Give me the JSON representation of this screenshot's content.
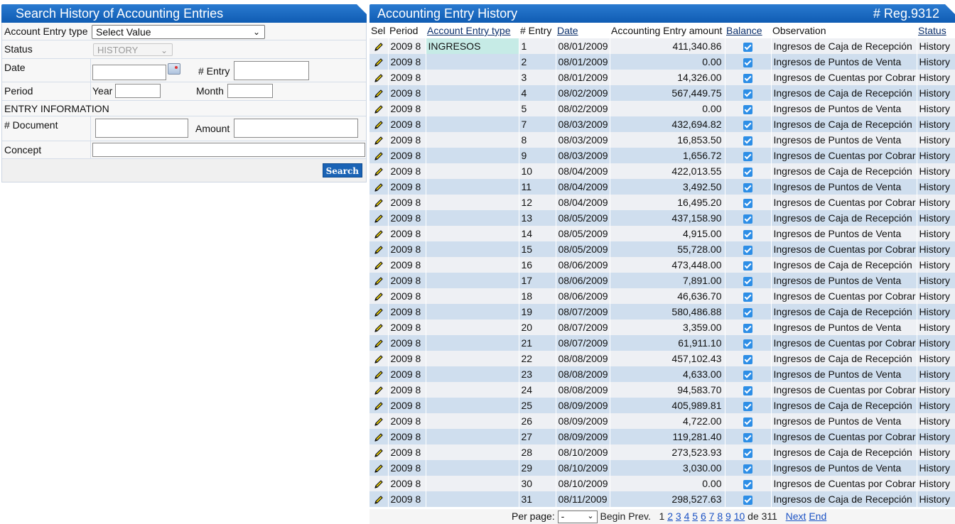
{
  "search_panel": {
    "title": "Search History of Accounting Entries",
    "fields": {
      "account_entry_type_label": "Account Entry type",
      "account_entry_type_value": "Select Value",
      "status_label": "Status",
      "status_value": "HISTORY",
      "date_label": "Date",
      "entry_label": "# Entry",
      "period_label": "Period",
      "year_label": "Year",
      "month_label": "Month",
      "entry_info_label": "ENTRY INFORMATION",
      "document_label": "# Document",
      "amount_label": "Amount",
      "concept_label": "Concept"
    },
    "search_button": "Search"
  },
  "history_panel": {
    "title": "Accounting Entry History",
    "reg_count": "# Reg.9312",
    "columns": [
      "Sel",
      "Period",
      "Account Entry type",
      "# Entry",
      "Date",
      "Accounting Entry amount",
      "Balance",
      "Observation",
      "Status"
    ],
    "rows": [
      {
        "period": "2009 8",
        "type": "INGRESOS",
        "entry": "1",
        "date": "08/01/2009",
        "amount": "411,340.86",
        "observation": "Ingresos de Caja de Recepción",
        "status": "History"
      },
      {
        "period": "2009 8",
        "type": "",
        "entry": "2",
        "date": "08/01/2009",
        "amount": "0.00",
        "observation": "Ingresos de Puntos de Venta",
        "status": "History"
      },
      {
        "period": "2009 8",
        "type": "",
        "entry": "3",
        "date": "08/01/2009",
        "amount": "14,326.00",
        "observation": "Ingresos de Cuentas por Cobrar",
        "status": "History"
      },
      {
        "period": "2009 8",
        "type": "",
        "entry": "4",
        "date": "08/02/2009",
        "amount": "567,449.75",
        "observation": "Ingresos de Caja de Recepción",
        "status": "History"
      },
      {
        "period": "2009 8",
        "type": "",
        "entry": "5",
        "date": "08/02/2009",
        "amount": "0.00",
        "observation": "Ingresos de Puntos de Venta",
        "status": "History"
      },
      {
        "period": "2009 8",
        "type": "",
        "entry": "7",
        "date": "08/03/2009",
        "amount": "432,694.82",
        "observation": "Ingresos de Caja de Recepción",
        "status": "History"
      },
      {
        "period": "2009 8",
        "type": "",
        "entry": "8",
        "date": "08/03/2009",
        "amount": "16,853.50",
        "observation": "Ingresos de Puntos de Venta",
        "status": "History"
      },
      {
        "period": "2009 8",
        "type": "",
        "entry": "9",
        "date": "08/03/2009",
        "amount": "1,656.72",
        "observation": "Ingresos de Cuentas por Cobrar",
        "status": "History"
      },
      {
        "period": "2009 8",
        "type": "",
        "entry": "10",
        "date": "08/04/2009",
        "amount": "422,013.55",
        "observation": "Ingresos de Caja de Recepción",
        "status": "History"
      },
      {
        "period": "2009 8",
        "type": "",
        "entry": "11",
        "date": "08/04/2009",
        "amount": "3,492.50",
        "observation": "Ingresos de Puntos de Venta",
        "status": "History"
      },
      {
        "period": "2009 8",
        "type": "",
        "entry": "12",
        "date": "08/04/2009",
        "amount": "16,495.20",
        "observation": "Ingresos de Cuentas por Cobrar",
        "status": "History"
      },
      {
        "period": "2009 8",
        "type": "",
        "entry": "13",
        "date": "08/05/2009",
        "amount": "437,158.90",
        "observation": "Ingresos de Caja de Recepción",
        "status": "History"
      },
      {
        "period": "2009 8",
        "type": "",
        "entry": "14",
        "date": "08/05/2009",
        "amount": "4,915.00",
        "observation": "Ingresos de Puntos de Venta",
        "status": "History"
      },
      {
        "period": "2009 8",
        "type": "",
        "entry": "15",
        "date": "08/05/2009",
        "amount": "55,728.00",
        "observation": "Ingresos de Cuentas por Cobrar",
        "status": "History"
      },
      {
        "period": "2009 8",
        "type": "",
        "entry": "16",
        "date": "08/06/2009",
        "amount": "473,448.00",
        "observation": "Ingresos de Caja de Recepción",
        "status": "History"
      },
      {
        "period": "2009 8",
        "type": "",
        "entry": "17",
        "date": "08/06/2009",
        "amount": "7,891.00",
        "observation": "Ingresos de Puntos de Venta",
        "status": "History"
      },
      {
        "period": "2009 8",
        "type": "",
        "entry": "18",
        "date": "08/06/2009",
        "amount": "46,636.70",
        "observation": "Ingresos de Cuentas por Cobrar",
        "status": "History"
      },
      {
        "period": "2009 8",
        "type": "",
        "entry": "19",
        "date": "08/07/2009",
        "amount": "580,486.88",
        "observation": "Ingresos de Caja de Recepción",
        "status": "History"
      },
      {
        "period": "2009 8",
        "type": "",
        "entry": "20",
        "date": "08/07/2009",
        "amount": "3,359.00",
        "observation": "Ingresos de Puntos de Venta",
        "status": "History"
      },
      {
        "period": "2009 8",
        "type": "",
        "entry": "21",
        "date": "08/07/2009",
        "amount": "61,911.10",
        "observation": "Ingresos de Cuentas por Cobrar",
        "status": "History"
      },
      {
        "period": "2009 8",
        "type": "",
        "entry": "22",
        "date": "08/08/2009",
        "amount": "457,102.43",
        "observation": "Ingresos de Caja de Recepción",
        "status": "History"
      },
      {
        "period": "2009 8",
        "type": "",
        "entry": "23",
        "date": "08/08/2009",
        "amount": "4,633.00",
        "observation": "Ingresos de Puntos de Venta",
        "status": "History"
      },
      {
        "period": "2009 8",
        "type": "",
        "entry": "24",
        "date": "08/08/2009",
        "amount": "94,583.70",
        "observation": "Ingresos de Cuentas por Cobrar",
        "status": "History"
      },
      {
        "period": "2009 8",
        "type": "",
        "entry": "25",
        "date": "08/09/2009",
        "amount": "405,989.81",
        "observation": "Ingresos de Caja de Recepción",
        "status": "History"
      },
      {
        "period": "2009 8",
        "type": "",
        "entry": "26",
        "date": "08/09/2009",
        "amount": "4,722.00",
        "observation": "Ingresos de Puntos de Venta",
        "status": "History"
      },
      {
        "period": "2009 8",
        "type": "",
        "entry": "27",
        "date": "08/09/2009",
        "amount": "119,281.40",
        "observation": "Ingresos de Cuentas por Cobrar",
        "status": "History"
      },
      {
        "period": "2009 8",
        "type": "",
        "entry": "28",
        "date": "08/10/2009",
        "amount": "273,523.93",
        "observation": "Ingresos de Caja de Recepción",
        "status": "History"
      },
      {
        "period": "2009 8",
        "type": "",
        "entry": "29",
        "date": "08/10/2009",
        "amount": "3,030.00",
        "observation": "Ingresos de Puntos de Venta",
        "status": "History"
      },
      {
        "period": "2009 8",
        "type": "",
        "entry": "30",
        "date": "08/10/2009",
        "amount": "0.00",
        "observation": "Ingresos de Cuentas por Cobrar",
        "status": "History"
      },
      {
        "period": "2009 8",
        "type": "",
        "entry": "31",
        "date": "08/11/2009",
        "amount": "298,527.63",
        "observation": "Ingresos de Caja de Recepción",
        "status": "History"
      }
    ],
    "pager": {
      "per_page_label": "Per page:",
      "per_page_value": "-",
      "begin": "Begin",
      "prev": "Prev.",
      "current_page": "1",
      "pages": [
        "2",
        "3",
        "4",
        "5",
        "6",
        "7",
        "8",
        "9",
        "10"
      ],
      "of_label": "de",
      "total_pages": "311",
      "next": "Next",
      "end": "End"
    }
  },
  "colors": {
    "header_blue": "#1566c0",
    "row_even": "#cfdeee",
    "row_odd": "#eef0f4",
    "highlight": "#c6ebe6",
    "link": "#1b52c4"
  }
}
